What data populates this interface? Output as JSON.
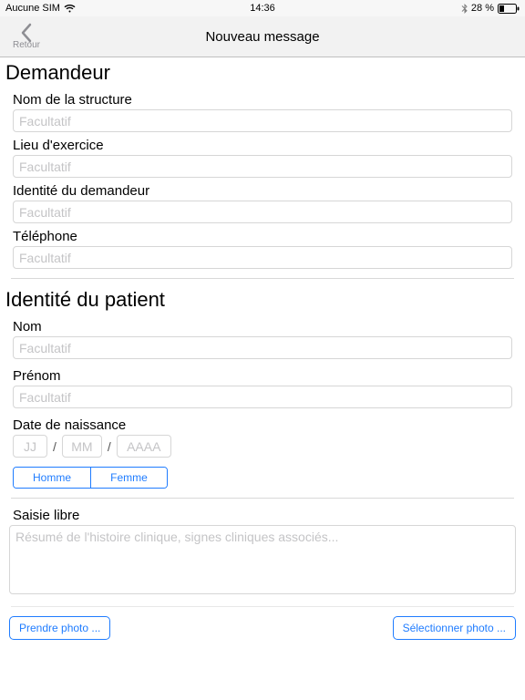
{
  "status": {
    "carrier": "Aucune SIM",
    "time": "14:36",
    "battery_pct": "28 %"
  },
  "nav": {
    "back_label": "Retour",
    "title": "Nouveau message"
  },
  "requester": {
    "section_title": "Demandeur",
    "structure_label": "Nom de la structure",
    "structure_placeholder": "Facultatif",
    "practice_label": "Lieu d'exercice",
    "practice_placeholder": "Facultatif",
    "identity_label": "Identité du demandeur",
    "identity_placeholder": "Facultatif",
    "phone_label": "Téléphone",
    "phone_placeholder": "Facultatif"
  },
  "patient": {
    "section_title": "Identité du patient",
    "lastname_label": "Nom",
    "lastname_placeholder": "Facultatif",
    "firstname_label": "Prénom",
    "firstname_placeholder": "Facultatif",
    "dob_label": "Date de naissance",
    "dob_day_placeholder": "JJ",
    "dob_month_placeholder": "MM",
    "dob_year_placeholder": "AAAA",
    "gender_male": "Homme",
    "gender_female": "Femme"
  },
  "freeform": {
    "label": "Saisie libre",
    "placeholder": "Résumé de l'histoire clinique, signes cliniques associés..."
  },
  "photos": {
    "take_photo": "Prendre photo ...",
    "select_photo": "Sélectionner photo ..."
  }
}
